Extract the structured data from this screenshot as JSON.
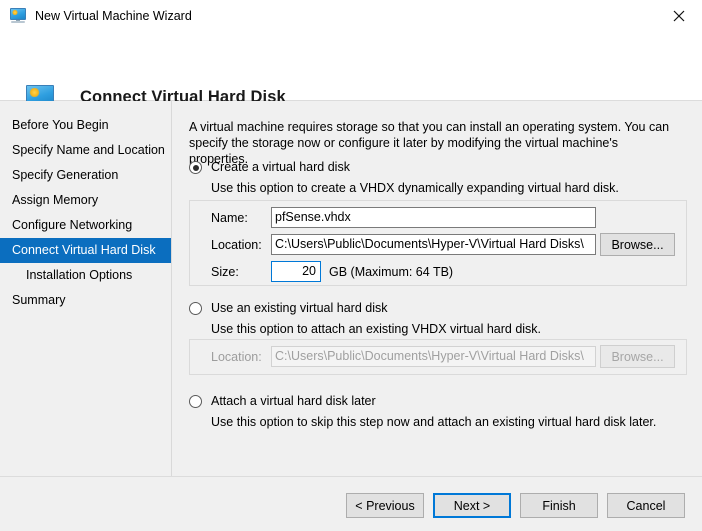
{
  "window": {
    "title": "New Virtual Machine Wizard",
    "title_icon": "virtual-machine-monitor-icon",
    "close_label": "✕"
  },
  "header": {
    "icon": "virtual-machine-monitor-icon",
    "title": "Connect Virtual Hard Disk"
  },
  "sidebar": {
    "items": [
      {
        "label": "Before You Begin",
        "selected": false,
        "indent": false
      },
      {
        "label": "Specify Name and Location",
        "selected": false,
        "indent": false
      },
      {
        "label": "Specify Generation",
        "selected": false,
        "indent": false
      },
      {
        "label": "Assign Memory",
        "selected": false,
        "indent": false
      },
      {
        "label": "Configure Networking",
        "selected": false,
        "indent": false
      },
      {
        "label": "Connect Virtual Hard Disk",
        "selected": true,
        "indent": false
      },
      {
        "label": "Installation Options",
        "selected": false,
        "indent": true
      },
      {
        "label": "Summary",
        "selected": false,
        "indent": false
      }
    ]
  },
  "main": {
    "intro": "A virtual machine requires storage so that you can install an operating system. You can specify the storage now or configure it later by modifying the virtual machine's properties.",
    "options": [
      {
        "label": "Create a virtual hard disk",
        "description": "Use this option to create a VHDX dynamically expanding virtual hard disk.",
        "selected": true
      },
      {
        "label": "Use an existing virtual hard disk",
        "description": "Use this option to attach an existing VHDX virtual hard disk.",
        "selected": false
      },
      {
        "label": "Attach a virtual hard disk later",
        "description": "Use this option to skip this step now and attach an existing virtual hard disk later.",
        "selected": false
      }
    ],
    "create_group": {
      "name_label": "Name:",
      "name_value": "pfSense.vhdx",
      "location_label": "Location:",
      "location_value": "C:\\Users\\Public\\Documents\\Hyper-V\\Virtual Hard Disks\\",
      "browse_label": "Browse...",
      "size_label": "Size:",
      "size_value": "20",
      "size_units": "GB (Maximum: 64 TB)"
    },
    "existing_group": {
      "location_label": "Location:",
      "location_value": "C:\\Users\\Public\\Documents\\Hyper-V\\Virtual Hard Disks\\",
      "browse_label": "Browse..."
    }
  },
  "footer": {
    "buttons": [
      {
        "label": "< Previous",
        "default": false
      },
      {
        "label": "Next >",
        "default": true
      },
      {
        "label": "Finish",
        "default": false
      },
      {
        "label": "Cancel",
        "default": false
      }
    ]
  },
  "colors": {
    "accent": "#0078d7",
    "selection": "#0b6ebf",
    "panel": "#f0f0f0",
    "divider": "#dcdcdc"
  }
}
